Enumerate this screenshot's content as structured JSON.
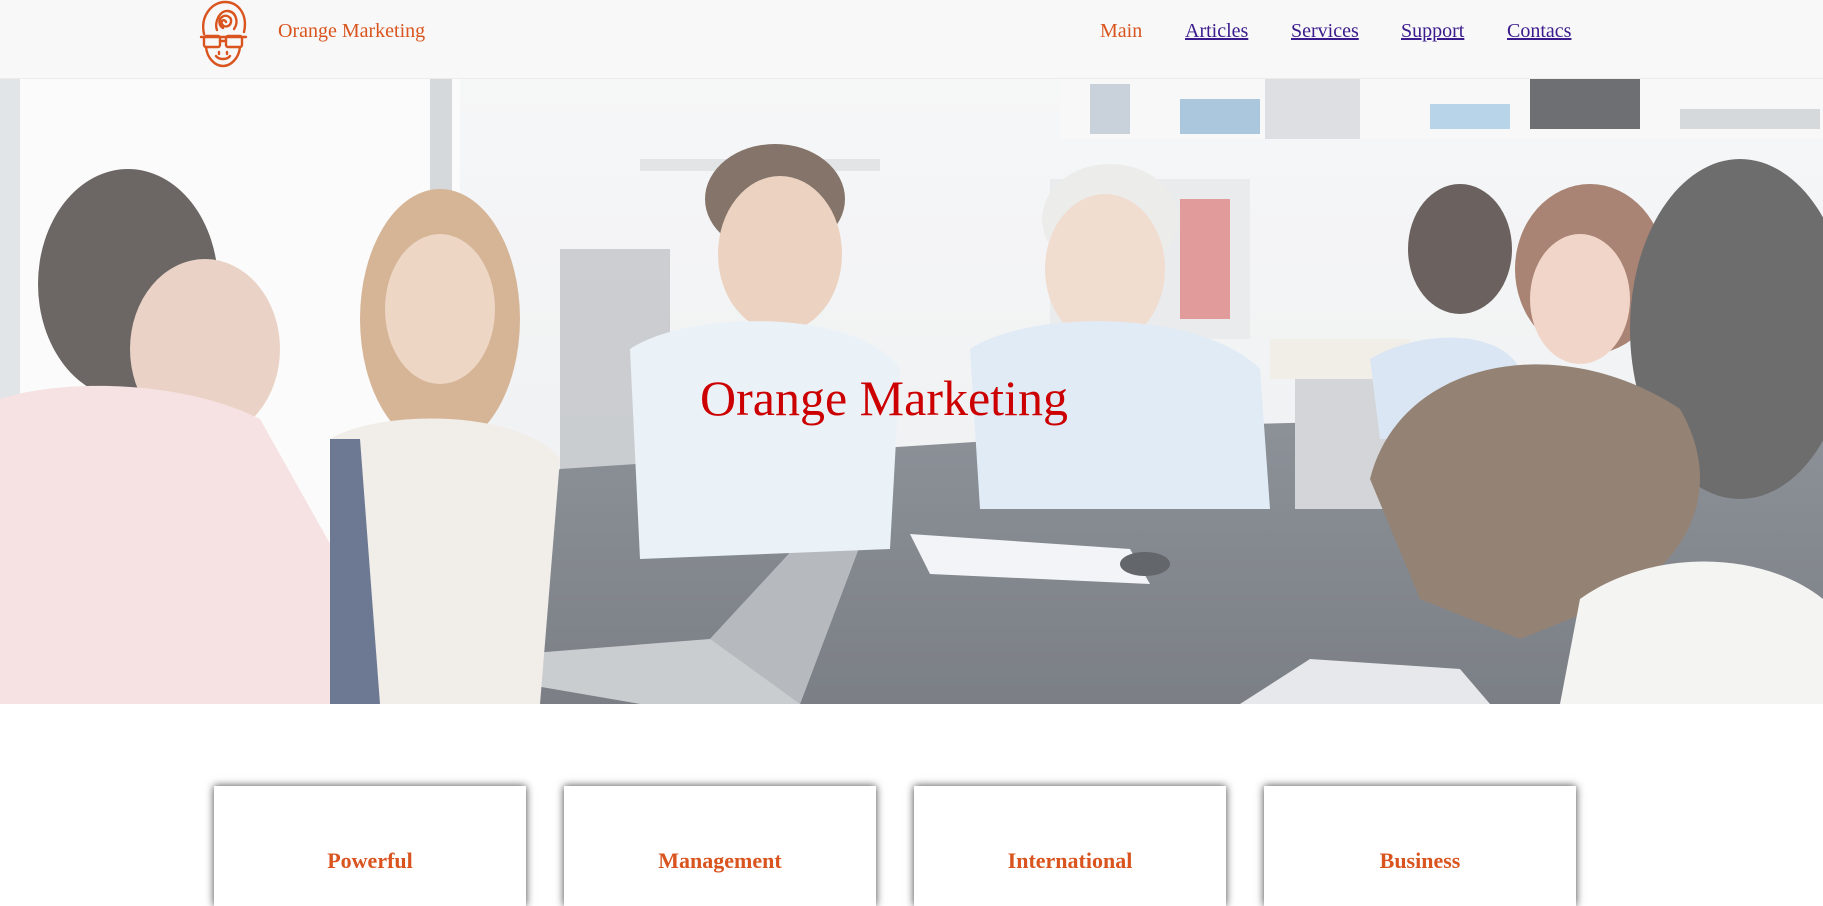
{
  "header": {
    "brand": "Orange Marketing",
    "nav": [
      {
        "label": "Main",
        "active": true
      },
      {
        "label": "Articles",
        "active": false
      },
      {
        "label": "Services",
        "active": false
      },
      {
        "label": "Support",
        "active": false
      },
      {
        "label": "Contacs",
        "active": false
      }
    ]
  },
  "hero": {
    "title": "Orange Marketing",
    "image": "office-meeting-photo"
  },
  "cards": [
    {
      "title": "Powerful"
    },
    {
      "title": "Management"
    },
    {
      "title": "International"
    },
    {
      "title": "Business"
    }
  ],
  "colors": {
    "accent": "#d9541e",
    "hero_title": "#cc0000",
    "link": "#3a1a8c",
    "header_bg": "#f8f8f8"
  }
}
